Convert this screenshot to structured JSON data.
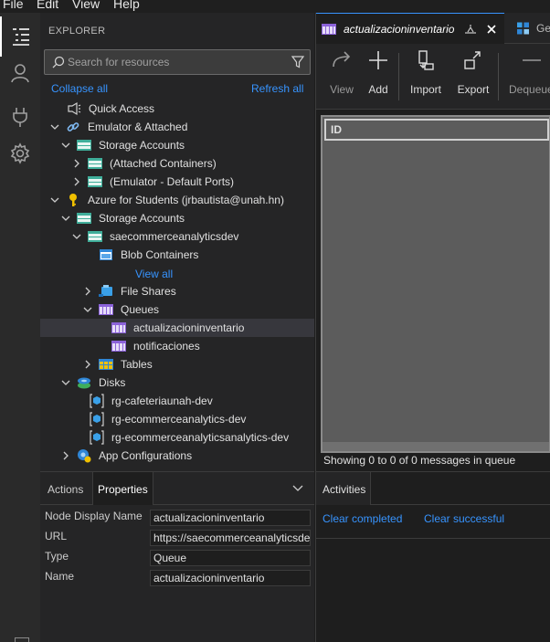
{
  "menu": {
    "file": "File",
    "edit": "Edit",
    "view": "View",
    "help": "Help"
  },
  "explorer": {
    "title": "EXPLORER",
    "search_placeholder": "Search for resources",
    "collapse_all": "Collapse all",
    "refresh_all": "Refresh all"
  },
  "tree": {
    "quick_access": "Quick Access",
    "emulator": "Emulator & Attached",
    "storage_accounts_1": "Storage Accounts",
    "attached_containers": "(Attached Containers)",
    "emulator_ports": "(Emulator - Default Ports)",
    "azure_students": "Azure for Students (jrbautista@unah.hn)",
    "storage_accounts_2": "Storage Accounts",
    "saecommerce": "saecommerceanalyticsdev",
    "blob_containers": "Blob Containers",
    "view_all": "View all",
    "file_shares": "File Shares",
    "queues": "Queues",
    "queue_1": "actualizacioninventario",
    "queue_2": "notificaciones",
    "tables": "Tables",
    "disks": "Disks",
    "disk_1": "rg-cafeteriaunah-dev",
    "disk_2": "rg-ecommerceanalytics-dev",
    "disk_3": "rg-ecommerceanalyticsanalytics-dev",
    "app_configurations": "App Configurations"
  },
  "bottom_left": {
    "tab_actions": "Actions",
    "tab_properties": "Properties",
    "props": {
      "node_display_name_label": "Node Display Name",
      "node_display_name": "actualizacioninventario",
      "url_label": "URL",
      "url": "https://saecommerceanalyticsdev.queue.core.windows.net/actualizacioninventario",
      "type_label": "Type",
      "type": "Queue",
      "name_label": "Name",
      "name": "actualizacioninventario"
    }
  },
  "editor": {
    "tab_active": "actualizacioninventario",
    "tab_next": "Ge",
    "toolbar": {
      "view": "View",
      "add": "Add",
      "import": "Import",
      "export": "Export",
      "dequeue": "Dequeue"
    },
    "grid_column": "ID",
    "status": "Showing 0 to 0 of 0 messages in queue"
  },
  "activities": {
    "tab": "Activities",
    "clear_completed": "Clear completed",
    "clear_successful": "Clear successful"
  },
  "colors": {
    "accent": "#3794ff",
    "queue_icon": "#8b62d9",
    "storage_icon": "#3fae9a",
    "key_icon": "#f0c000"
  }
}
